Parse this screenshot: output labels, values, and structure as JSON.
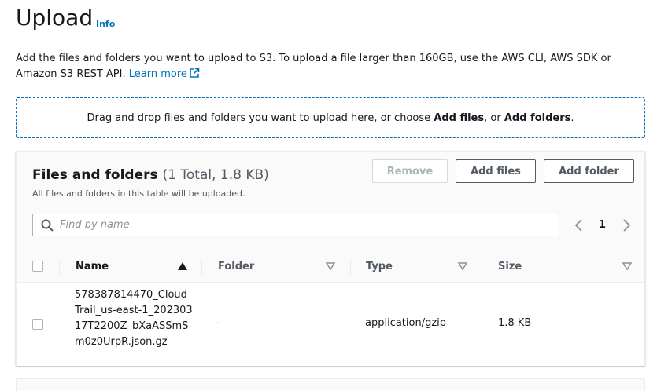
{
  "header": {
    "title": "Upload",
    "info_label": "Info"
  },
  "description": {
    "text": "Add the files and folders you want to upload to S3. To upload a file larger than 160GB, use the AWS CLI, AWS SDK or Amazon S3 REST API.",
    "learn_more": "Learn more"
  },
  "dropzone": {
    "prefix": "Drag and drop files and folders you want to upload here, or choose ",
    "add_files": "Add files",
    "middle": ", or ",
    "add_folders": "Add folders",
    "suffix": "."
  },
  "files_panel": {
    "title": "Files and folders",
    "count": "(1 Total, 1.8 KB)",
    "subtitle": "All files and folders in this table will be uploaded.",
    "remove_label": "Remove",
    "add_files_label": "Add files",
    "add_folder_label": "Add folder",
    "search_placeholder": "Find by name",
    "page_number": "1",
    "columns": {
      "name": "Name",
      "folder": "Folder",
      "type": "Type",
      "size": "Size"
    },
    "rows": [
      {
        "name": "578387814470_CloudTrail_us-east-1_20230317T2200Z_bXaASSmSm0z0UrpR.json.gz",
        "folder": "-",
        "type": "application/gzip",
        "size": "1.8 KB"
      }
    ]
  },
  "colors": {
    "link": "#0073bb",
    "text": "#16191f",
    "muted": "#545b64",
    "border": "#aab7b8"
  }
}
